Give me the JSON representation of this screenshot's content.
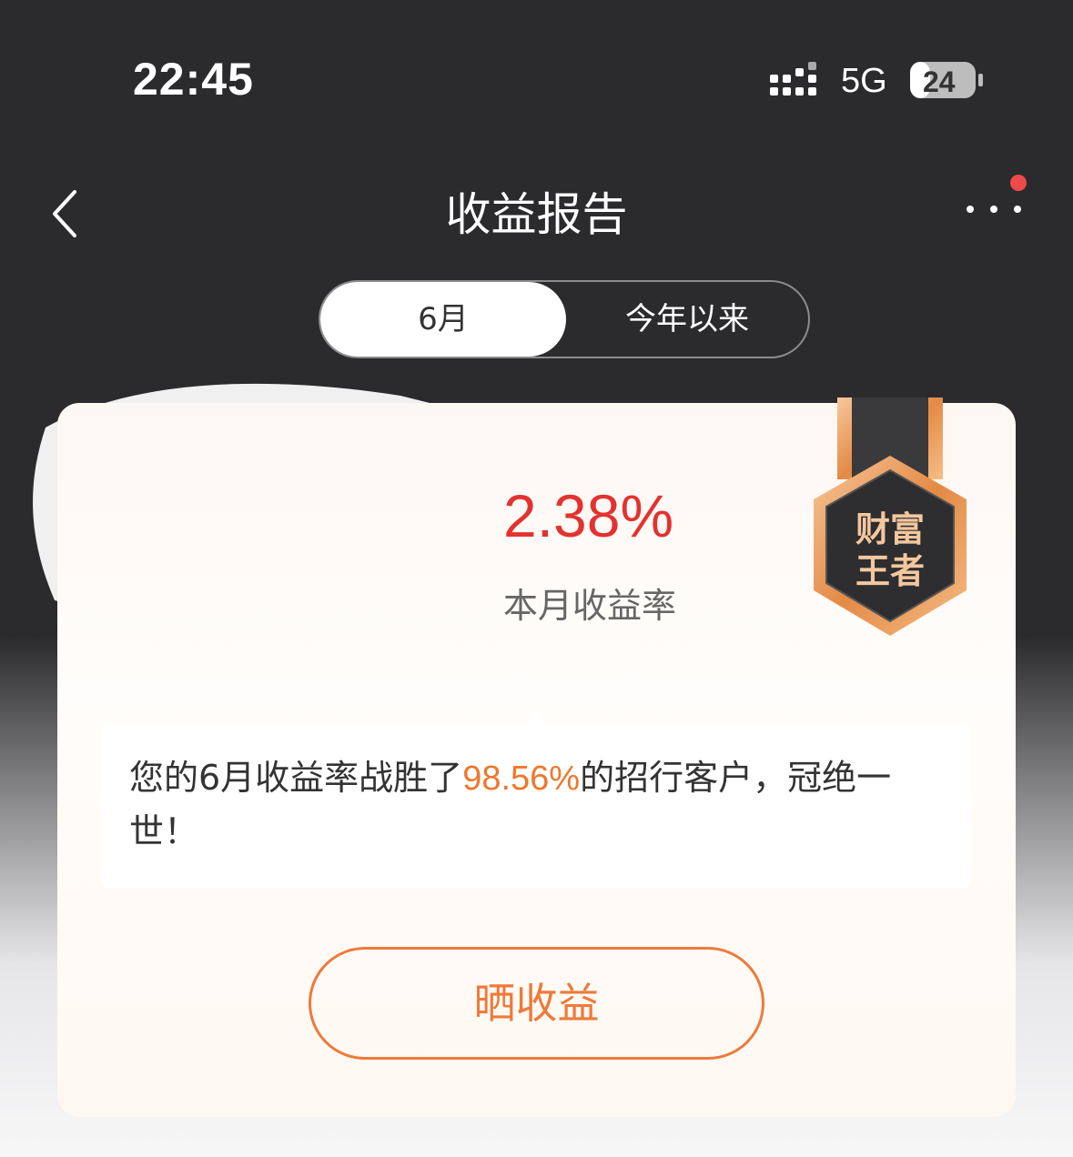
{
  "status_bar": {
    "time": "22:45",
    "network": "5G",
    "battery": "24"
  },
  "nav": {
    "title": "收益报告",
    "back_icon": "chevron-left-icon",
    "more_icon": "more-dots-icon"
  },
  "tabs": [
    {
      "label": "6月",
      "active": true
    },
    {
      "label": "今年以来",
      "active": false
    }
  ],
  "card": {
    "return_rate": "2.38%",
    "return_rate_label": "本月收益率",
    "badge": {
      "line1": "财富",
      "line2": "王者"
    },
    "message": {
      "before": "您的6月收益率战胜了",
      "percent": "98.56%",
      "after": "的招行客户，冠绝一世！"
    },
    "share_button": "晒收益"
  },
  "colors": {
    "accent_red": "#e3322f",
    "accent_orange": "#ee7a3a",
    "highlight": "#f0772c",
    "dark_bg": "#2b2b2e"
  }
}
